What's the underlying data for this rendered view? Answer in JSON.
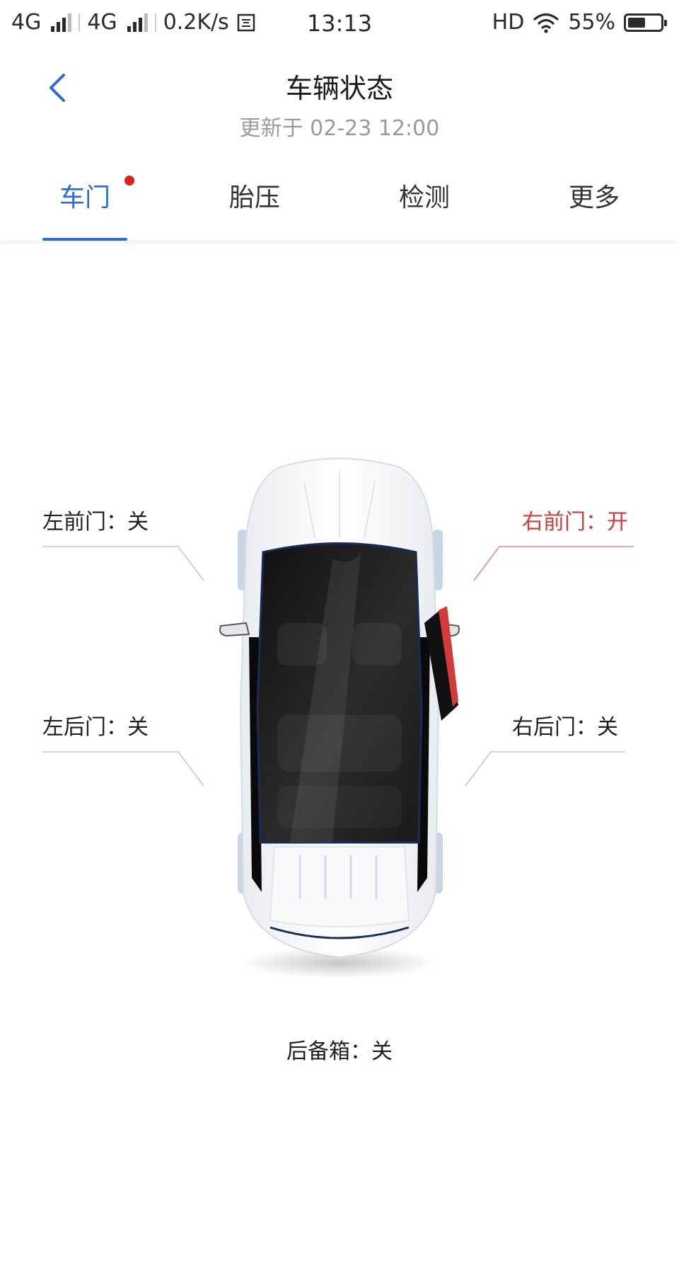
{
  "status_bar": {
    "network_1": "4G",
    "network_2": "4G",
    "speed": "0.2K/s",
    "time": "13:13",
    "hd": "HD",
    "battery": "55%",
    "battery_level": 0.55
  },
  "header": {
    "title": "车辆状态",
    "subtitle": "更新于 02-23 12:00"
  },
  "tabs": [
    {
      "label": "车门",
      "active": true,
      "badge": true
    },
    {
      "label": "胎压",
      "active": false
    },
    {
      "label": "检测",
      "active": false
    },
    {
      "label": "更多",
      "active": false
    }
  ],
  "doors": {
    "front_left": "左前门：关",
    "front_right": "右前门：开",
    "rear_left": "左后门：关",
    "rear_right": "右后门：关",
    "trunk": "后备箱：关"
  },
  "colors": {
    "accent": "#2f6bd4",
    "open": "#d33a3a",
    "badge": "#e02020"
  }
}
